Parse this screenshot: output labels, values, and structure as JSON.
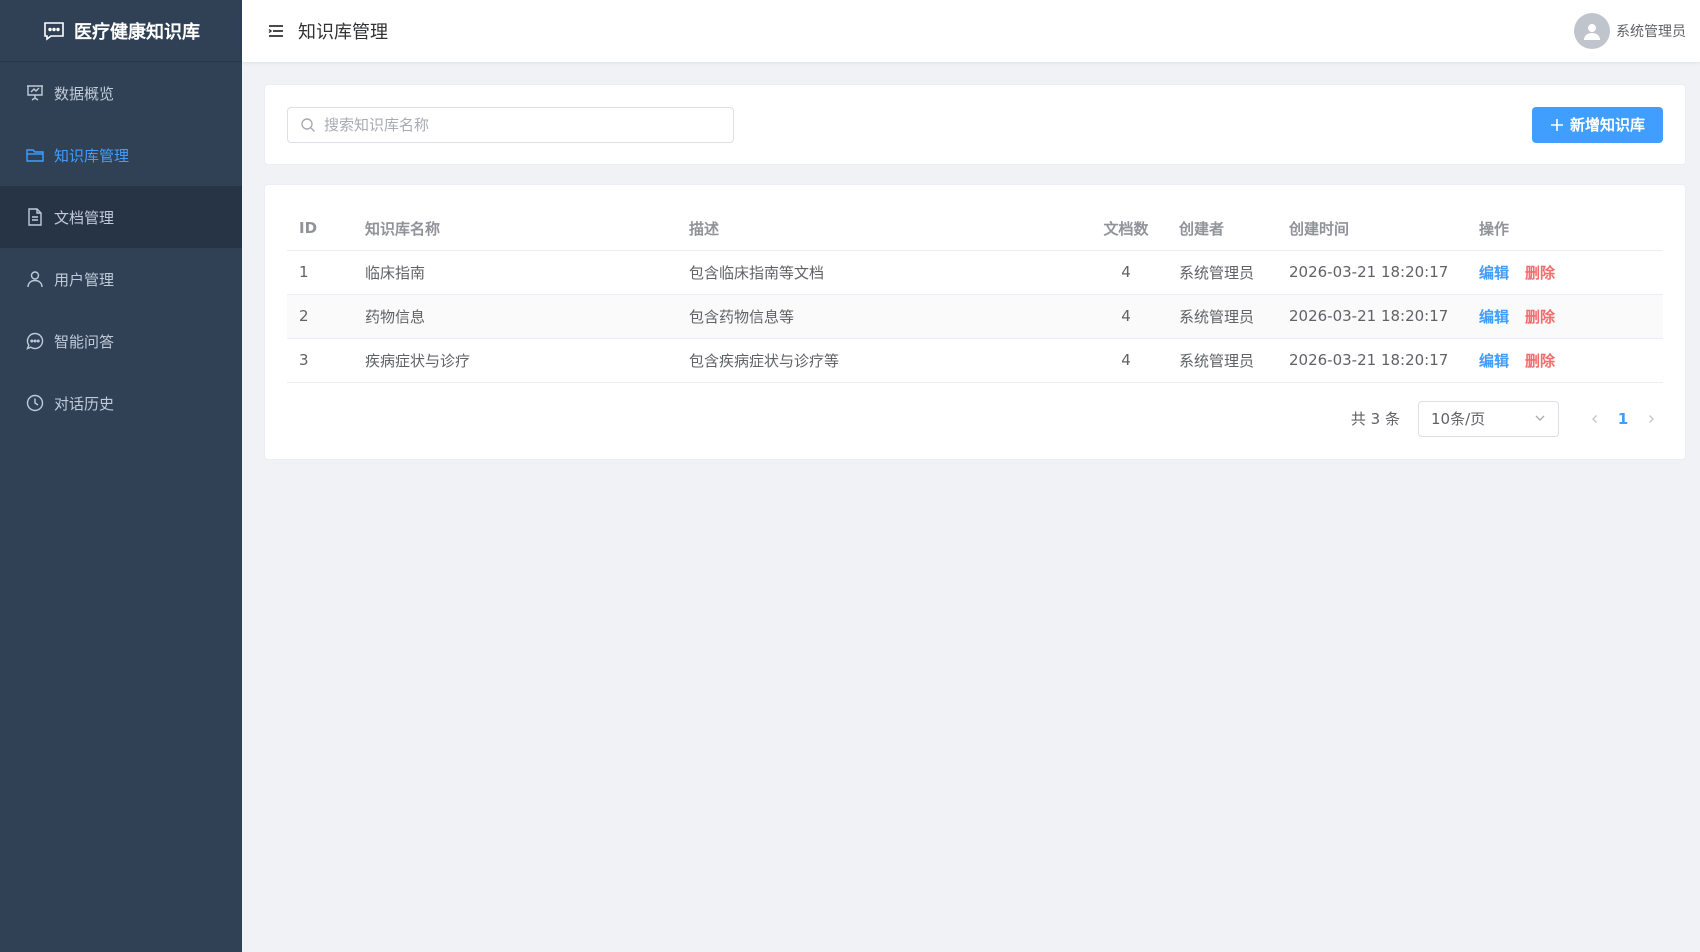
{
  "brand": {
    "title": "医疗健康知识库"
  },
  "sidebar": {
    "items": [
      {
        "label": "数据概览",
        "icon": "presentation-icon"
      },
      {
        "label": "知识库管理",
        "icon": "folder-icon"
      },
      {
        "label": "文档管理",
        "icon": "document-icon"
      },
      {
        "label": "用户管理",
        "icon": "user-icon"
      },
      {
        "label": "智能问答",
        "icon": "chat-icon"
      },
      {
        "label": "对话历史",
        "icon": "clock-icon"
      }
    ],
    "active_index": 1
  },
  "header": {
    "title": "知识库管理",
    "user_name": "系统管理员"
  },
  "search": {
    "placeholder": "搜索知识库名称",
    "value": ""
  },
  "toolbar": {
    "add_label": "新增知识库"
  },
  "table": {
    "columns": [
      "ID",
      "知识库名称",
      "描述",
      "文档数",
      "创建者",
      "创建时间",
      "操作"
    ],
    "rows": [
      {
        "id": "1",
        "name": "临床指南",
        "description": "包含临床指南等文档",
        "doc_count": "4",
        "creator": "系统管理员",
        "created_at": "2026-03-21 18:20:17"
      },
      {
        "id": "2",
        "name": "药物信息",
        "description": "包含药物信息等",
        "doc_count": "4",
        "creator": "系统管理员",
        "created_at": "2026-03-21 18:20:17"
      },
      {
        "id": "3",
        "name": "疾病症状与诊疗",
        "description": "包含疾病症状与诊疗等",
        "doc_count": "4",
        "creator": "系统管理员",
        "created_at": "2026-03-21 18:20:17"
      }
    ],
    "actions": {
      "edit": "编辑",
      "delete": "删除"
    }
  },
  "pagination": {
    "total_label": "共 3 条",
    "page_size": "10条/页",
    "current_page": "1"
  },
  "colors": {
    "sidebar_bg": "#304156",
    "accent": "#409eff",
    "danger": "#f56c6c"
  }
}
